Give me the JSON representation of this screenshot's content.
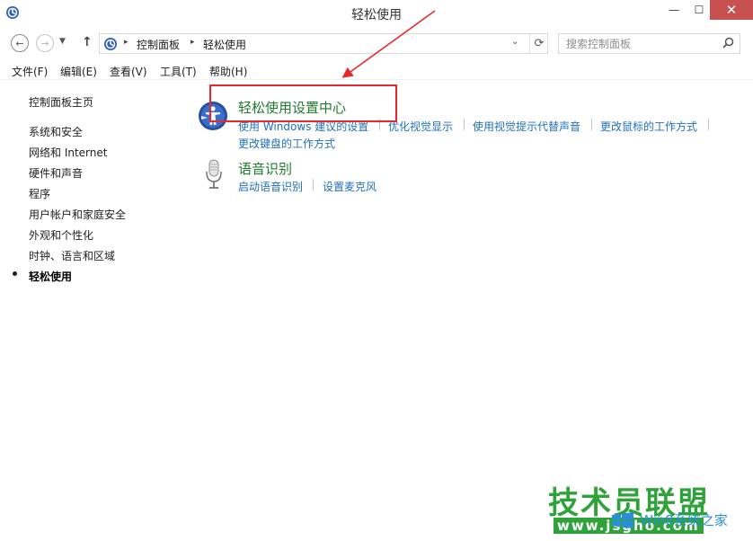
{
  "window": {
    "title": "轻松使用",
    "minimize_glyph": "—",
    "maximize_glyph": "☐",
    "close_glyph": "✕"
  },
  "nav": {
    "back_glyph": "←",
    "forward_glyph": "→",
    "recent_glyph": "▼",
    "up_glyph": "↑",
    "breadcrumb": [
      "控制面板",
      "轻松使用"
    ],
    "breadcrumb_sep": "▸",
    "dropdown_glyph": "⌄",
    "refresh_glyph": "⟳",
    "search_placeholder": "搜索控制面板"
  },
  "menu": [
    "文件(F)",
    "编辑(E)",
    "查看(V)",
    "工具(T)",
    "帮助(H)"
  ],
  "sidebar": {
    "home": "控制面板主页",
    "items": [
      "系统和安全",
      "网络和 Internet",
      "硬件和声音",
      "程序",
      "用户帐户和家庭安全",
      "外观和个性化",
      "时钟、语言和区域",
      "轻松使用"
    ],
    "current_index": 7
  },
  "categories": [
    {
      "title": "轻松使用设置中心",
      "icon": "ease-of-access-icon",
      "links": [
        "使用 Windows 建议的设置",
        "优化视觉显示",
        "使用视觉提示代替声音",
        "更改鼠标的工作方式",
        "更改键盘的工作方式"
      ]
    },
    {
      "title": "语音识别",
      "icon": "microphone-icon",
      "links": [
        "启动语音识别",
        "设置麦克风"
      ]
    }
  ],
  "watermark": {
    "main": "技术员联盟",
    "url": "www.jsgho.com",
    "sub": "Win8系统之家"
  },
  "colors": {
    "category_title": "#1f7a2d",
    "link": "#1f6fbd",
    "close_button": "#c75050",
    "annotation": "#e8262b",
    "watermark_green": "#2fa33a",
    "watermark_blue": "#2a8fd8"
  }
}
